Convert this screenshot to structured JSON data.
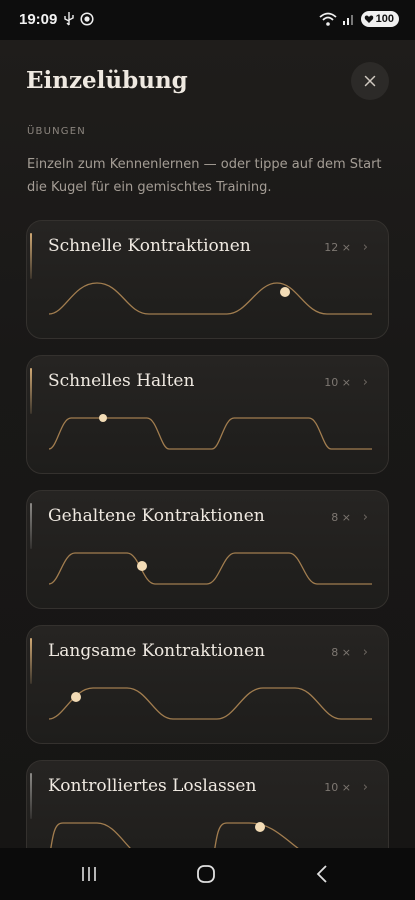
{
  "status_bar": {
    "time": "19:09",
    "battery": "100"
  },
  "header": {
    "title": "Einzelübung",
    "close_icon": "close-icon"
  },
  "section_label": "ÜBUNGEN",
  "intro_text": "Einzeln zum Kennenlernen — oder tippe auf dem Start die Kugel für ein gemischtes Training.",
  "exercises": [
    {
      "title": "Schnelle Kontraktionen",
      "count": "12 ×",
      "accent": "gold"
    },
    {
      "title": "Schnelles Halten",
      "count": "10 ×",
      "accent": "gold"
    },
    {
      "title": "Gehaltene Kontraktionen",
      "count": "8 ×",
      "accent": "dim"
    },
    {
      "title": "Langsame Kontraktionen",
      "count": "8 ×",
      "accent": "gold"
    },
    {
      "title": "Kontrolliertes Loslassen",
      "count": "10 ×",
      "accent": "dim"
    }
  ],
  "colors": {
    "accent_gold": "#d9b07a",
    "background": "#191817",
    "card": "#24221f"
  }
}
